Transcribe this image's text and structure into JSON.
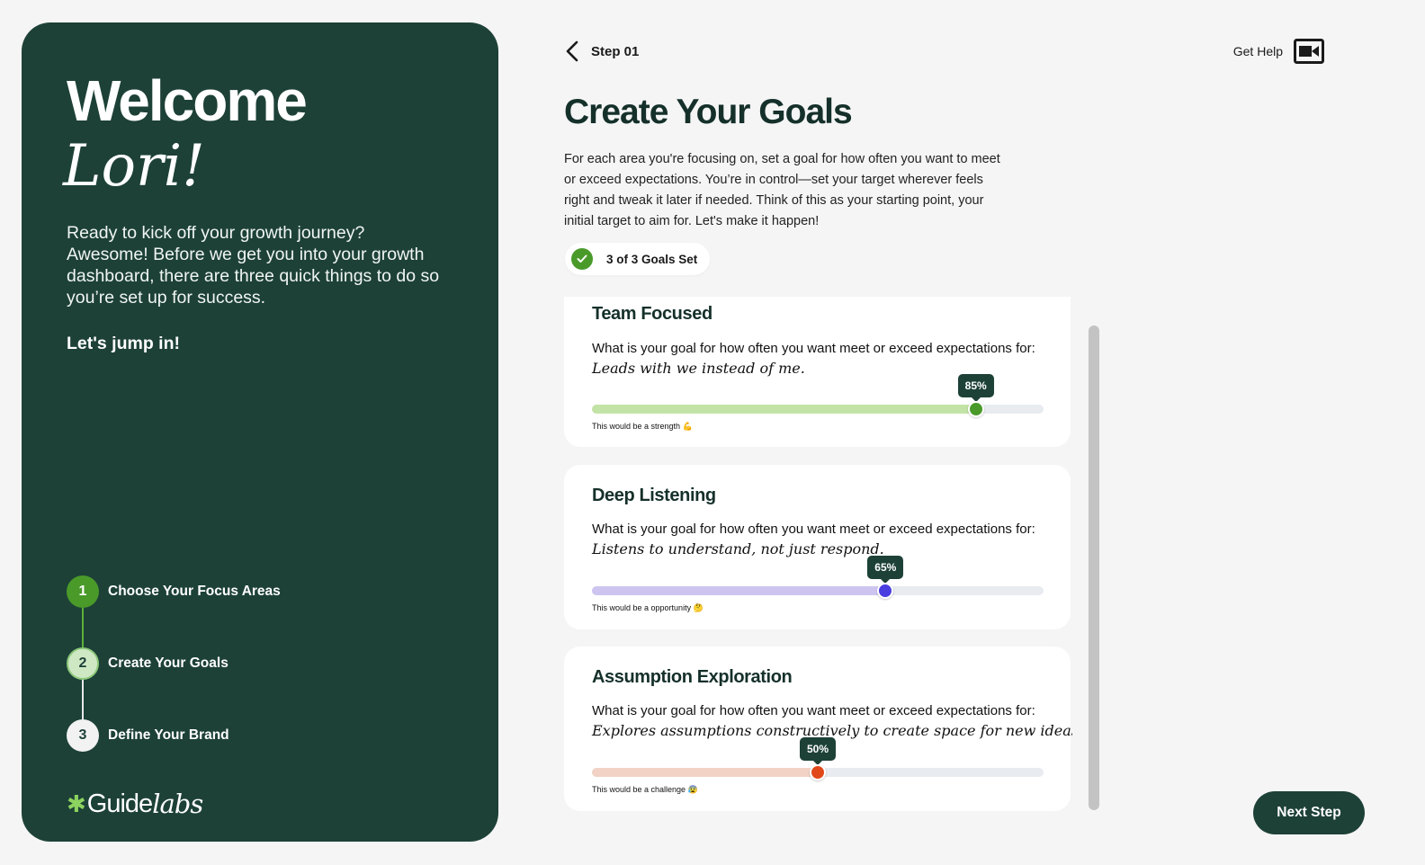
{
  "sidebar": {
    "welcome": "Welcome",
    "name": "Lori!",
    "intro": "Ready to kick off your growth journey? Awesome! Before we get you into your growth dashboard, there are three quick things to do so you’re set up for success.",
    "jump": "Let's jump in!",
    "steps": [
      {
        "number": "1",
        "label": "Choose Your Focus Areas",
        "state": "completed"
      },
      {
        "number": "2",
        "label": "Create Your Goals",
        "state": "current"
      },
      {
        "number": "3",
        "label": "Define Your Brand",
        "state": "upcoming"
      }
    ],
    "logo": {
      "guide": "Guide",
      "labs": "labs",
      "icon": "asterisk-leaf-icon"
    }
  },
  "header": {
    "back_icon": "chevron-left-icon",
    "step_label": "Step 01",
    "help_label": "Get Help",
    "help_icon": "video-camera-icon"
  },
  "main": {
    "title": "Create Your Goals",
    "description": "For each area you're focusing on, set a goal for how often you want to meet or exceed expectations. You’re in control—set your target wherever feels right and tweak it later if needed. Think of this as your starting point, your initial target to aim for. Let's make it happen!",
    "goals_status": "3 of 3 Goals Set",
    "cards": [
      {
        "title": "Team Focused",
        "question": "What is your goal for how often you want meet or exceed expectations for:",
        "quote": "Leads with we instead of me.",
        "value": 85,
        "value_label": "85%",
        "note": "This would be a strength 💪",
        "fill_color": "#c3e3a6",
        "thumb_color": "#4a9a2a"
      },
      {
        "title": "Deep Listening",
        "question": "What is your goal for how often you want meet or exceed expectations for:",
        "quote": "Listens to understand, not just respond.",
        "value": 65,
        "value_label": "65%",
        "note": "This would be a opportunity 🤔",
        "fill_color": "#cdc5ef",
        "thumb_color": "#4a3ee0"
      },
      {
        "title": "Assumption Exploration",
        "question": "What is your goal for how often you want meet or exceed expectations for:",
        "quote": "Explores assumptions constructively to create space for new ideas.",
        "value": 50,
        "value_label": "50%",
        "note": "This would be a challenge 😰",
        "fill_color": "#f1d2c4",
        "thumb_color": "#e0481b"
      }
    ]
  },
  "footer": {
    "next_label": "Next Step"
  }
}
